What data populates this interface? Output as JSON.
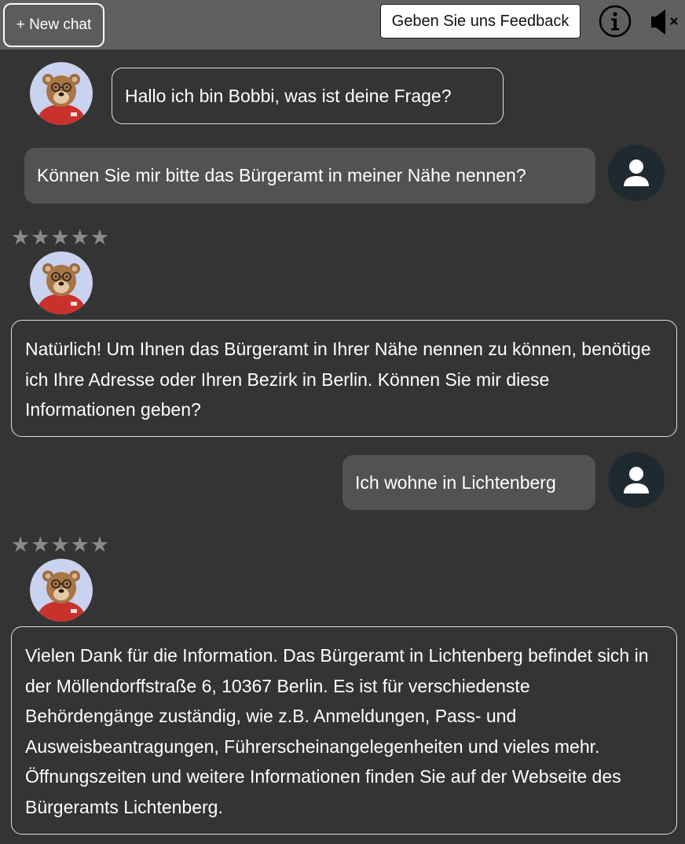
{
  "topbar": {
    "new_chat_label": "+ New chat",
    "feedback_label": "Geben Sie uns Feedback",
    "info_icon": "info-circle-icon",
    "mute_icon": "speaker-muted-icon"
  },
  "rating": {
    "star_char": "★",
    "max_stars": 5,
    "selected": 0
  },
  "messages": [
    {
      "role": "bot",
      "text": "Hallo ich bin Bobbi, was ist deine Frage?"
    },
    {
      "role": "user",
      "text": "Können Sie mir bitte das Bürgeramt in meiner Nähe nennen?"
    },
    {
      "role": "bot",
      "text": "Natürlich! Um Ihnen das Bürgeramt in Ihrer Nähe nennen zu können, benötige ich Ihre Adresse oder Ihren Bezirk in Berlin. Können Sie mir diese Informationen geben?"
    },
    {
      "role": "user",
      "text": "Ich wohne in Lichtenberg"
    },
    {
      "role": "bot",
      "text": "Vielen Dank für die Information. Das Bürgeramt in Lichtenberg befindet sich in der Möllendorffstraße 6, 10367 Berlin. Es ist für verschiedenste Behördengänge zuständig, wie z.B. Anmeldungen, Pass- und Ausweisbeantragungen, Führerscheinangelegenheiten und vieles mehr. Öffnungszeiten und weitere Informationen finden Sie auf der Webseite des Bürgeramts Lichtenberg."
    }
  ],
  "colors": {
    "background": "#343434",
    "topbar": "#606060",
    "user_bubble": "#525252",
    "user_avatar": "#1f2a30",
    "bot_avatar_bg": "#c9d2ef",
    "bear_shirt": "#c8312c",
    "star_inactive": "#8a8a8a"
  }
}
